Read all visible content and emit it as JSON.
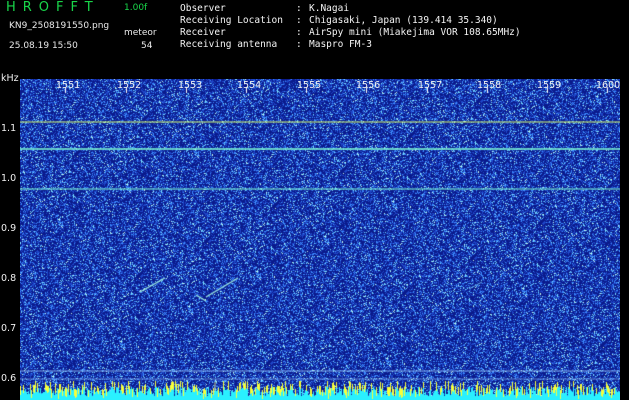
{
  "header": {
    "brand": "HROFFT",
    "version": "1.00f",
    "filename": "KN9_2508191550.png",
    "datetime": "25.08.19 15:50",
    "meteor_label": "meteor",
    "meteor_count": "54",
    "fields": [
      {
        "label": "Observer",
        "sep": ":",
        "value": "K.Nagai"
      },
      {
        "label": "Receiving Location",
        "sep": ":",
        "value": "Chigasaki, Japan (139.414 35.340)"
      },
      {
        "label": "Receiver",
        "sep": ":",
        "value": "AirSpy mini (Miakejima VOR 108.65MHz)"
      },
      {
        "label": "Receiving antenna",
        "sep": ":",
        "value": "Maspro FM-3"
      }
    ]
  },
  "spectrogram": {
    "y_unit": "kHz",
    "y_ticks": [
      "1.1",
      "1.0",
      "0.9",
      "0.8",
      "0.7",
      "0.6"
    ],
    "x_ticks": [
      "1551",
      "1552",
      "1553",
      "1554",
      "1555",
      "1556",
      "1557",
      "1558",
      "1559",
      "1600"
    ],
    "colors": {
      "background": "#0a1a8c",
      "signal": "#7fffd4",
      "trace": "#d7ff6a",
      "noise": "#3c8cff"
    }
  }
}
